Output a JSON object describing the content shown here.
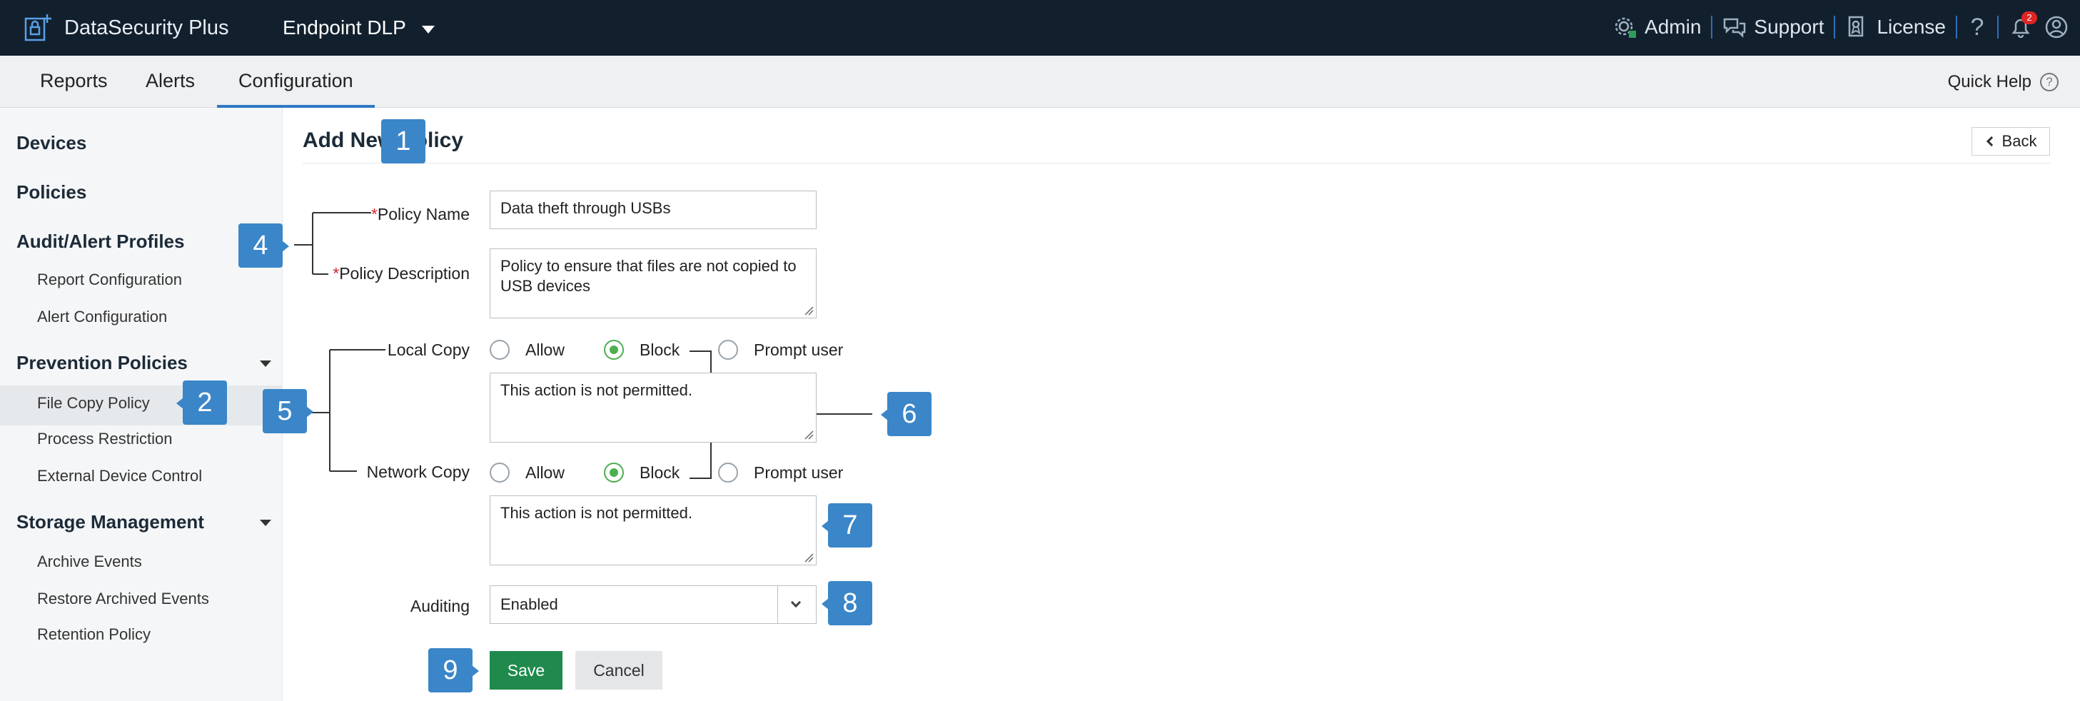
{
  "app": {
    "brand": "DataSecurity Plus",
    "product": "Endpoint DLP"
  },
  "topnav": {
    "admin": "Admin",
    "support": "Support",
    "license": "License",
    "help_glyph": "?",
    "notifications_count": "2",
    "icons": [
      "admin-icon",
      "support-icon",
      "license-icon",
      "help-icon",
      "bell-icon",
      "user-icon"
    ]
  },
  "tabs": [
    {
      "label": "Reports",
      "active": false
    },
    {
      "label": "Alerts",
      "active": false
    },
    {
      "label": "Configuration",
      "active": true
    }
  ],
  "quick_help": {
    "label": "Quick Help",
    "glyph": "?"
  },
  "sidebar": {
    "devices": "Devices",
    "policies": "Policies",
    "audit_alert_profiles": "Audit/Alert Profiles",
    "report_configuration": "Report Configuration",
    "alert_configuration": "Alert Configuration",
    "prevention_policies": "Prevention Policies",
    "file_copy_policy": "File Copy Policy",
    "process_restriction": "Process Restriction",
    "external_device_control": "External Device Control",
    "storage_management": "Storage Management",
    "archive_events": "Archive Events",
    "restore_archived_events": "Restore Archived Events",
    "retention_policy": "Retention Policy"
  },
  "page": {
    "title": "Add New Policy",
    "back": "Back"
  },
  "form": {
    "required_mark": "*",
    "policy_name_label": "Policy Name",
    "policy_name_value": "Data theft through USBs",
    "policy_description_label": "Policy Description",
    "policy_description_value": "Policy to ensure that files are not copied to USB devices",
    "local_copy_label": "Local Copy",
    "network_copy_label": "Network Copy",
    "options": {
      "allow": "Allow",
      "block": "Block",
      "prompt_user": "Prompt user"
    },
    "local_copy_selected": "Block",
    "network_copy_selected": "Block",
    "local_copy_message": "This action is not permitted.",
    "network_copy_message": "This action is not permitted.",
    "auditing_label": "Auditing",
    "auditing_value": "Enabled",
    "save": "Save",
    "cancel": "Cancel"
  },
  "callouts": {
    "c1": "1",
    "c2": "2",
    "c4": "4",
    "c5": "5",
    "c6": "6",
    "c7": "7",
    "c8": "8",
    "c9": "9"
  },
  "colors": {
    "topbar": "#12202e",
    "accent": "#2f78c4",
    "callout": "#3a86c8",
    "save": "#1f8a4c",
    "radio_on": "#4caf50",
    "required": "#d9262d"
  }
}
